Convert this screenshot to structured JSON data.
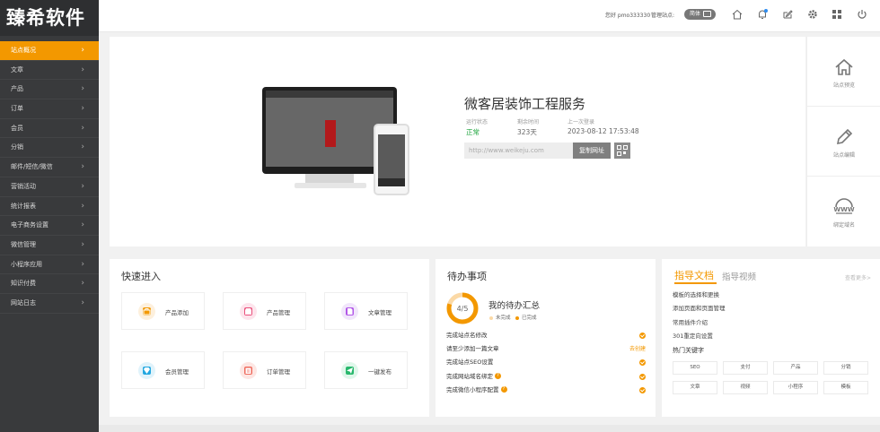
{
  "logo": "臻希软件",
  "sidebar": {
    "items": [
      {
        "label": "站点概况",
        "active": true
      },
      {
        "label": "文章"
      },
      {
        "label": "产品"
      },
      {
        "label": "订单"
      },
      {
        "label": "会员"
      },
      {
        "label": "分销"
      },
      {
        "label": "邮件/短信/微信"
      },
      {
        "label": "营销活动"
      },
      {
        "label": "统计报表"
      },
      {
        "label": "电子商务设置"
      },
      {
        "label": "微信管理"
      },
      {
        "label": "小程序应用"
      },
      {
        "label": "知识付费"
      },
      {
        "label": "网站日志"
      }
    ]
  },
  "topbar": {
    "greeting": "您好 pmo333330",
    "manage_site": "管理站点:",
    "lang": "简体",
    "icons": [
      "home-icon",
      "bell-icon",
      "edit-icon",
      "gear-icon",
      "apps-icon",
      "power-icon"
    ]
  },
  "site": {
    "name": "微客居装饰工程服务",
    "status_label": "运行状态",
    "status_value": "正常",
    "days_label": "剩余时间",
    "days_value": "323天",
    "login_label": "上一次登录",
    "login_value": "2023-08-12 17:53:48",
    "url": "http://www.weikeju.com",
    "copy_label": "复制网址"
  },
  "side_actions": [
    {
      "label": "站点预览",
      "icon": "home-outline-icon"
    },
    {
      "label": "站点编辑",
      "icon": "pencil-icon"
    },
    {
      "label": "绑定域名",
      "icon": "www-globe-icon"
    }
  ],
  "quick": {
    "title": "快速进入",
    "items": [
      {
        "label": "产品添加",
        "icon": "bag-icon",
        "bg": "#fdf0dd",
        "fg": "#f39800"
      },
      {
        "label": "产品管理",
        "icon": "shop-icon",
        "bg": "#fde4ec",
        "fg": "#ea4f7b"
      },
      {
        "label": "文章管理",
        "icon": "doc-icon",
        "bg": "#f1e6fb",
        "fg": "#b257e8"
      },
      {
        "label": "会员管理",
        "icon": "diamond-icon",
        "bg": "#e0f3fb",
        "fg": "#22a7e0"
      },
      {
        "label": "订单管理",
        "icon": "clipboard-icon",
        "bg": "#fde6e3",
        "fg": "#ef6a5c"
      },
      {
        "label": "一键发布",
        "icon": "send-icon",
        "bg": "#dff7ea",
        "fg": "#28b86c"
      }
    ]
  },
  "todo": {
    "title": "待办事项",
    "progress_text": "4/5",
    "progress": 0.8,
    "summary": "我的待办汇总",
    "legend_undone": "未完成",
    "legend_done": "已完成",
    "items": [
      {
        "label": "完成站点名修改",
        "state": "done"
      },
      {
        "label": "请至少添加一篇文章",
        "state": "go",
        "action": "去创建"
      },
      {
        "label": "完成站点SEO设置",
        "state": "done"
      },
      {
        "label": "完成网站域名绑定",
        "state": "done",
        "help": "?"
      },
      {
        "label": "完成微信小程序配置",
        "state": "done",
        "help": "?"
      }
    ]
  },
  "guide": {
    "tab_docs": "指导文档",
    "tab_video": "指导视频",
    "more": "查看更多>",
    "links": [
      "模板的选择和更换",
      "添加页面和页面管理",
      "常用插件介绍",
      "301重定向设置"
    ],
    "keywords_title": "热门关键字",
    "keywords": [
      "SEO",
      "支付",
      "产品",
      "分销",
      "文章",
      "视频",
      "小程序",
      "模板"
    ]
  }
}
